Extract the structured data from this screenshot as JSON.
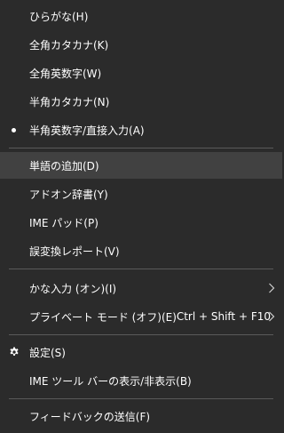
{
  "menu": {
    "hiragana": "ひらがな(H)",
    "zenkaku_katakana": "全角カタカナ(K)",
    "zenkaku_eisu": "全角英数字(W)",
    "hankaku_katakana": "半角カタカナ(N)",
    "hankaku_eisu": "半角英数字/直接入力(A)",
    "add_word": "単語の追加(D)",
    "addon_dictionary": "アドオン辞書(Y)",
    "ime_pad": "IME パッド(P)",
    "misconversion_report": "誤変換レポート(V)",
    "kana_input": "かな入力 (オン)(I)",
    "private_mode": "プライベート モード (オフ)(E)",
    "private_mode_shortcut": "Ctrl + Shift + F10",
    "settings": "設定(S)",
    "toolbar_toggle": "IME ツール バーの表示/非表示(B)",
    "feedback": "フィードバックの送信(F)"
  },
  "state": {
    "selected_mode": "hankaku_eisu",
    "highlighted_item": "add_word"
  },
  "icons": {
    "selected": "bullet-icon",
    "submenu": "chevron-right-icon",
    "settings": "gear-icon"
  },
  "colors": {
    "background": "#2b2b2b",
    "highlight": "#414141",
    "separator": "#5a5a5a",
    "text": "#ffffff"
  }
}
